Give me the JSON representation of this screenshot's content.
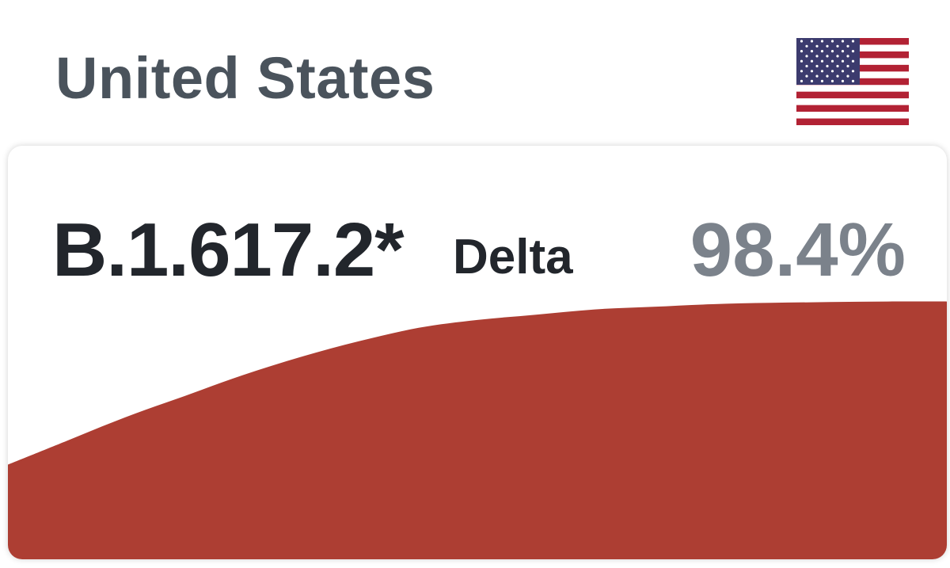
{
  "country": {
    "name": "United States",
    "flag_icon": "us-flag-icon"
  },
  "variant": {
    "code": "B.1.617.2*",
    "name": "Delta",
    "share": "98.4%"
  },
  "colors": {
    "area_fill": "#ad3e33",
    "text_primary": "#22262c",
    "text_muted": "#7b828b",
    "country_text": "#4a535c"
  },
  "chart_data": {
    "type": "area",
    "values": [
      0.36,
      0.45,
      0.54,
      0.62,
      0.7,
      0.77,
      0.83,
      0.88,
      0.91,
      0.93,
      0.95,
      0.96,
      0.97,
      0.975,
      0.978,
      0.98,
      0.98
    ],
    "ylim": [
      0,
      1
    ],
    "grid": false
  }
}
